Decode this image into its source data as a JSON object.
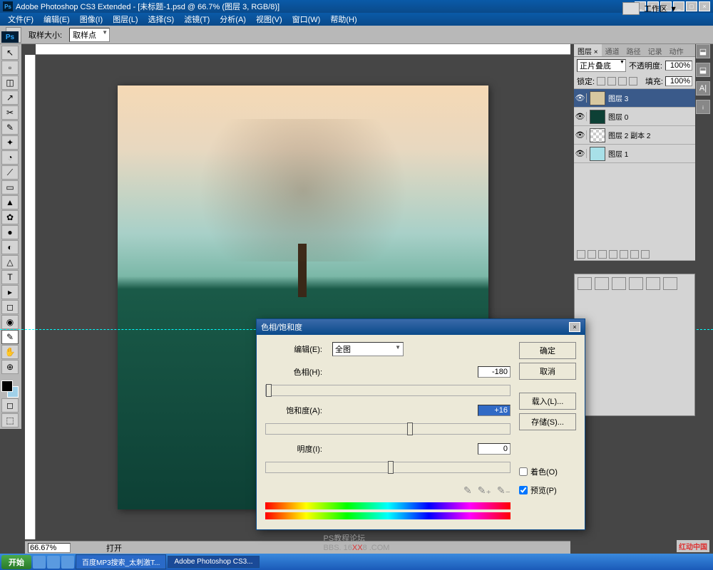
{
  "titlebar": {
    "ps_icon": "Ps",
    "title": "Adobe Photoshop CS3 Extended - [未标题-1.psd @ 66.7% (图层 3, RGB/8)]"
  },
  "menubar": [
    "文件(F)",
    "编辑(E)",
    "图像(I)",
    "图层(L)",
    "选择(S)",
    "滤镜(T)",
    "分析(A)",
    "视图(V)",
    "窗口(W)",
    "帮助(H)"
  ],
  "optionsbar": {
    "sample_size_label": "取样大小:",
    "sample_size_value": "取样点",
    "workspace_label": "工作区 ▼"
  },
  "tools_glyphs": [
    "↖",
    "▫",
    "◫",
    "↗",
    "✂",
    "✎",
    "✦",
    "◔",
    "⟋",
    "▭",
    "▲",
    "✿",
    "●",
    "◐",
    "△",
    "◯",
    "T",
    "▸",
    "◻",
    "◉",
    "✋",
    "⊕"
  ],
  "layers_panel": {
    "tabs": [
      "图层 ×",
      "通道",
      "路径",
      "记录",
      "动作"
    ],
    "blend_mode": "正片叠底",
    "opacity_label": "不透明度:",
    "opacity_value": "100%",
    "lock_label": "锁定:",
    "fill_label": "填充:",
    "fill_value": "100%",
    "layers": [
      {
        "name": "图层 3",
        "selected": true,
        "thumb_color": "#d8c8a0"
      },
      {
        "name": "图层 0",
        "selected": false,
        "thumb_color": "#0d4035"
      },
      {
        "name": "图层 2 副本 2",
        "selected": false,
        "thumb_color": "transparent"
      },
      {
        "name": "图层 1",
        "selected": false,
        "thumb_color": "#a8e0e8"
      }
    ]
  },
  "dialog": {
    "title": "色相/饱和度",
    "edit_label": "编辑(E):",
    "edit_value": "全图",
    "hue_label": "色相(H):",
    "hue_value": "-180",
    "sat_label": "饱和度(A):",
    "sat_value": "+16",
    "light_label": "明度(I):",
    "light_value": "0",
    "ok": "确定",
    "cancel": "取消",
    "load": "载入(L)...",
    "save": "存储(S)...",
    "colorize_label": "着色(O)",
    "preview_label": "预览(P)"
  },
  "statusbar": {
    "zoom": "66.67%",
    "status_text": "打开"
  },
  "taskbar": {
    "start": "开始",
    "items": [
      "百度MP3搜索_太刺激T...",
      "Adobe Photoshop CS3..."
    ]
  },
  "watermark": {
    "forum": "PS教程论坛",
    "bbs_pre": "BBS. 16",
    "bbs_mid": "XX",
    "bbs_post": "8 .COM",
    "brand": "红动中国"
  },
  "side_icons_glyphs": [
    "⬓",
    "⬓",
    "A|",
    "ᵢ"
  ]
}
